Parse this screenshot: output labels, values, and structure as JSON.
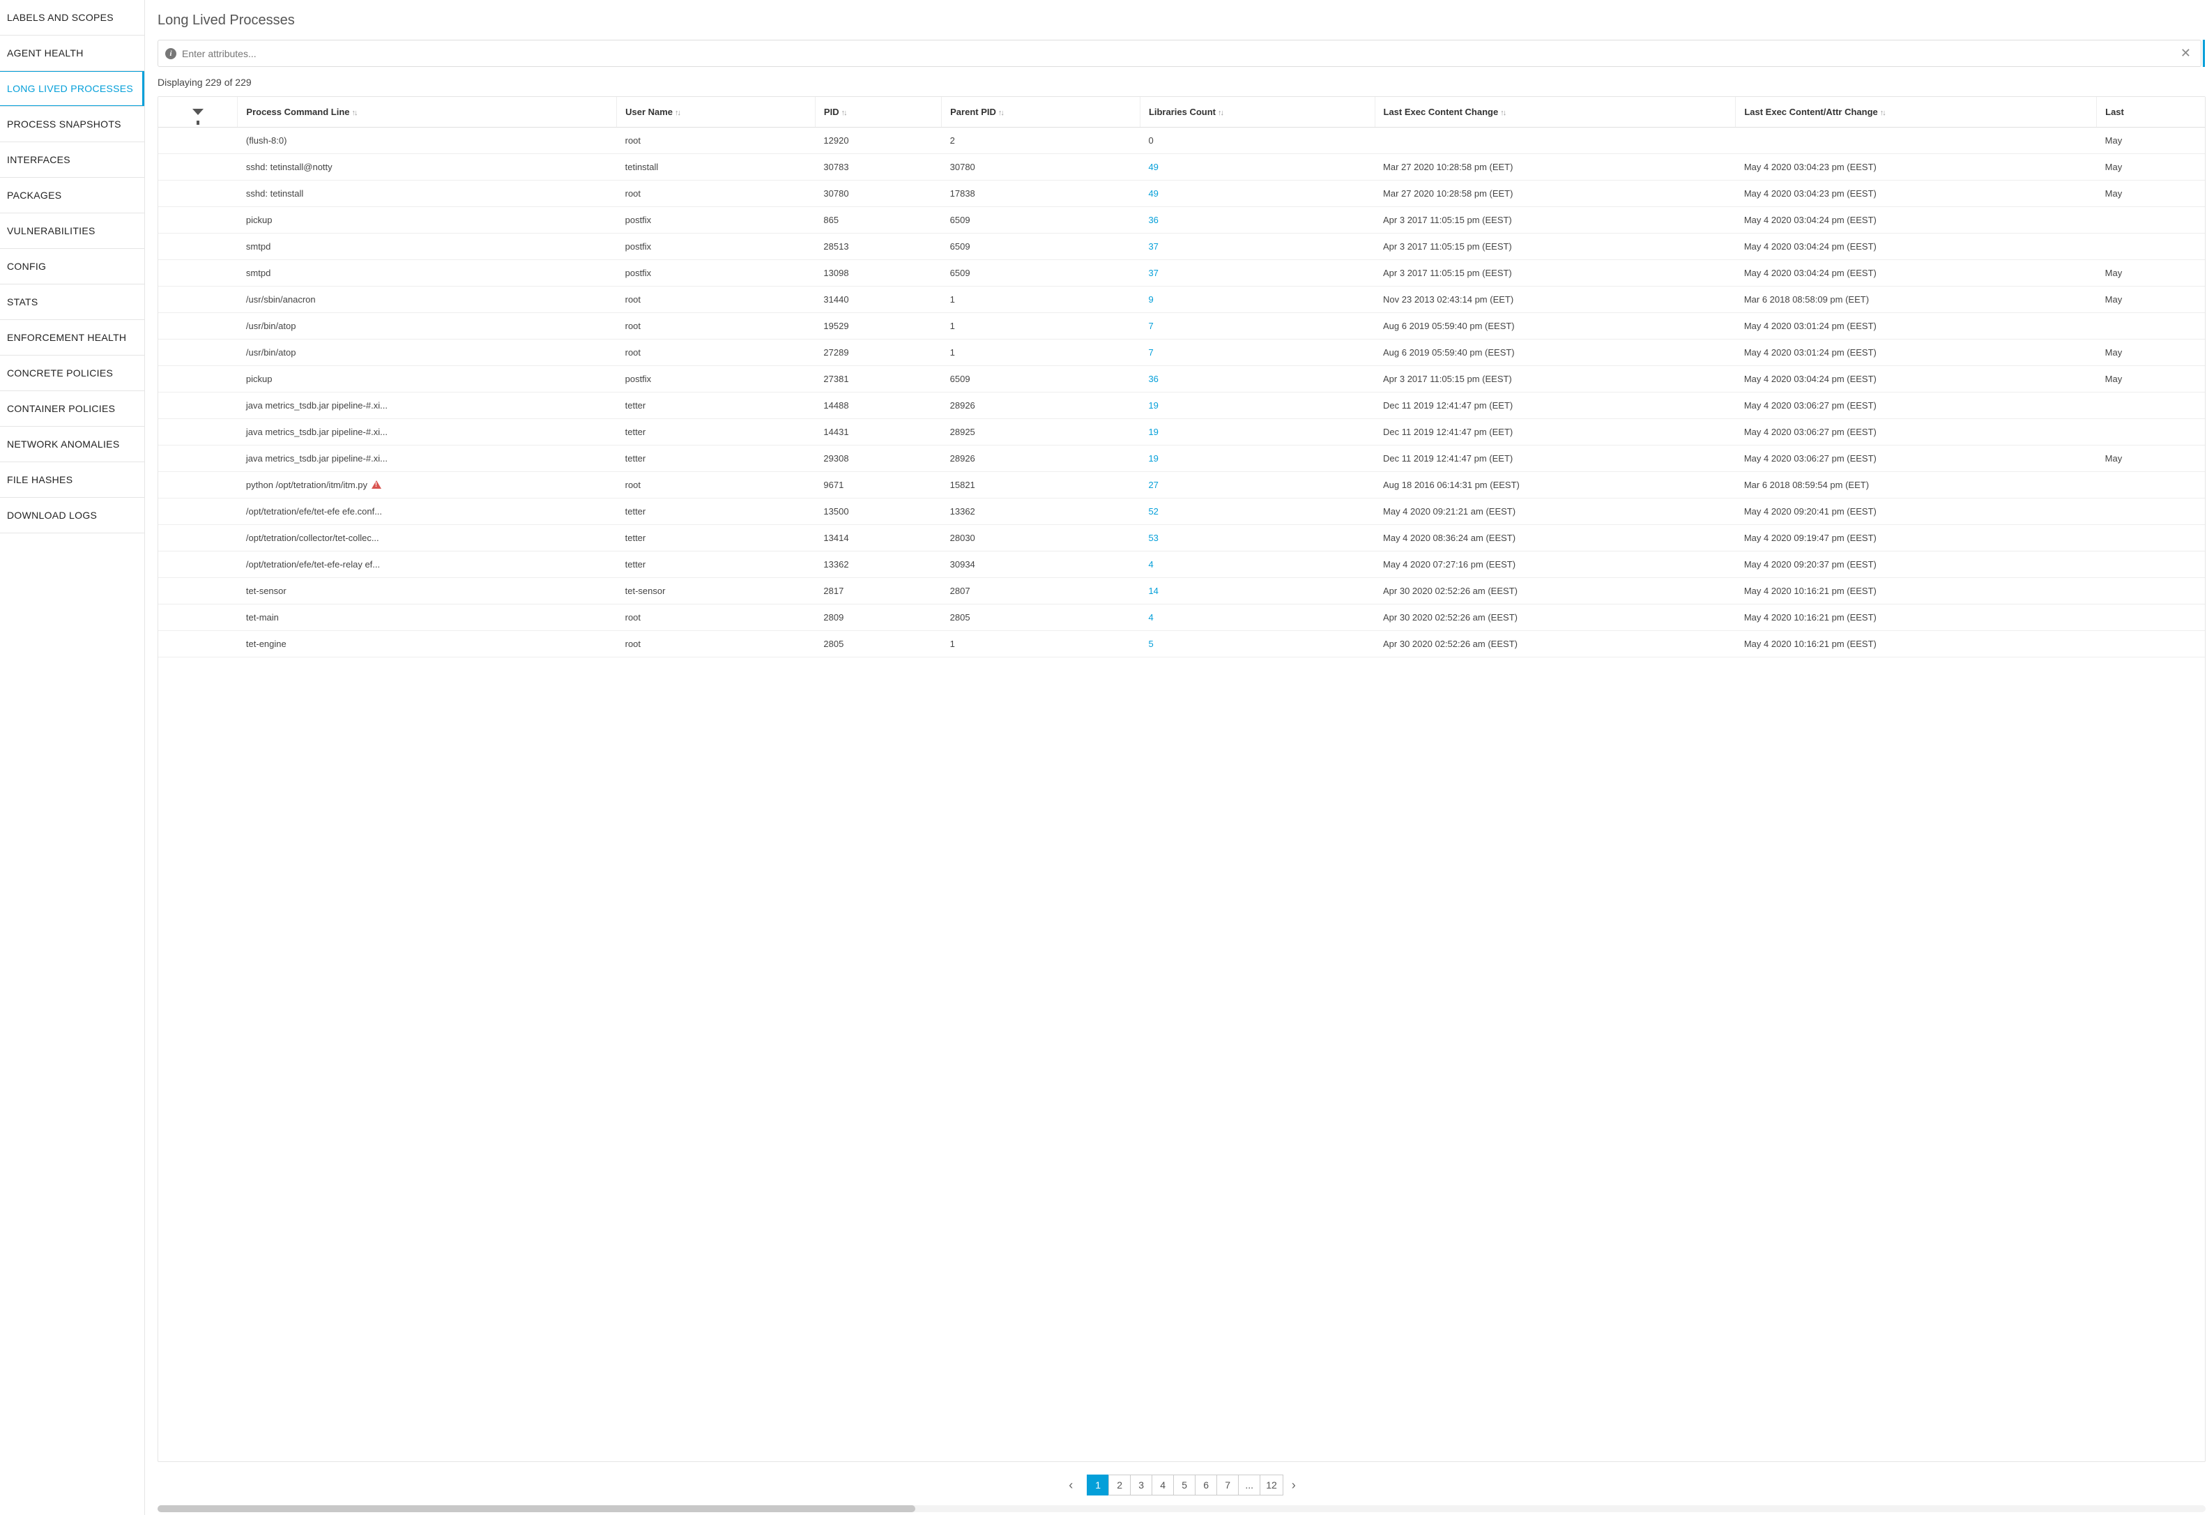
{
  "sidebar": {
    "items": [
      {
        "label": "LABELS AND SCOPES",
        "active": false
      },
      {
        "label": "AGENT HEALTH",
        "active": false
      },
      {
        "label": "LONG LIVED PROCESSES",
        "active": true
      },
      {
        "label": "PROCESS SNAPSHOTS",
        "active": false
      },
      {
        "label": "INTERFACES",
        "active": false
      },
      {
        "label": "PACKAGES",
        "active": false
      },
      {
        "label": "VULNERABILITIES",
        "active": false
      },
      {
        "label": "CONFIG",
        "active": false
      },
      {
        "label": "STATS",
        "active": false
      },
      {
        "label": "ENFORCEMENT HEALTH",
        "active": false
      },
      {
        "label": "CONCRETE POLICIES",
        "active": false
      },
      {
        "label": "CONTAINER POLICIES",
        "active": false
      },
      {
        "label": "NETWORK ANOMALIES",
        "active": false
      },
      {
        "label": "FILE HASHES",
        "active": false
      },
      {
        "label": "DOWNLOAD LOGS",
        "active": false
      }
    ]
  },
  "header": {
    "title": "Long Lived Processes",
    "filter_placeholder": "Enter attributes...",
    "count_text": "Displaying 229 of 229"
  },
  "table": {
    "columns": [
      "Process Command Line",
      "User Name",
      "PID",
      "Parent PID",
      "Libraries Count",
      "Last Exec Content Change",
      "Last Exec Content/Attr Change",
      "Last"
    ],
    "rows": [
      {
        "cmd": "(flush-8:0)",
        "warn": false,
        "user": "root",
        "pid": "12920",
        "ppid": "2",
        "libs": "0",
        "libs_link": false,
        "exec1": "",
        "exec2": "",
        "exec3": "May"
      },
      {
        "cmd": "sshd: tetinstall@notty",
        "warn": false,
        "user": "tetinstall",
        "pid": "30783",
        "ppid": "30780",
        "libs": "49",
        "libs_link": true,
        "exec1": "Mar 27 2020 10:28:58 pm (EET)",
        "exec2": "May 4 2020 03:04:23 pm (EEST)",
        "exec3": "May"
      },
      {
        "cmd": "sshd: tetinstall",
        "warn": false,
        "user": "root",
        "pid": "30780",
        "ppid": "17838",
        "libs": "49",
        "libs_link": true,
        "exec1": "Mar 27 2020 10:28:58 pm (EET)",
        "exec2": "May 4 2020 03:04:23 pm (EEST)",
        "exec3": "May"
      },
      {
        "cmd": "pickup",
        "warn": false,
        "user": "postfix",
        "pid": "865",
        "ppid": "6509",
        "libs": "36",
        "libs_link": true,
        "exec1": "Apr 3 2017 11:05:15 pm (EEST)",
        "exec2": "May 4 2020 03:04:24 pm (EEST)",
        "exec3": ""
      },
      {
        "cmd": "smtpd",
        "warn": false,
        "user": "postfix",
        "pid": "28513",
        "ppid": "6509",
        "libs": "37",
        "libs_link": true,
        "exec1": "Apr 3 2017 11:05:15 pm (EEST)",
        "exec2": "May 4 2020 03:04:24 pm (EEST)",
        "exec3": ""
      },
      {
        "cmd": "smtpd",
        "warn": false,
        "user": "postfix",
        "pid": "13098",
        "ppid": "6509",
        "libs": "37",
        "libs_link": true,
        "exec1": "Apr 3 2017 11:05:15 pm (EEST)",
        "exec2": "May 4 2020 03:04:24 pm (EEST)",
        "exec3": "May"
      },
      {
        "cmd": "/usr/sbin/anacron",
        "warn": false,
        "user": "root",
        "pid": "31440",
        "ppid": "1",
        "libs": "9",
        "libs_link": true,
        "exec1": "Nov 23 2013 02:43:14 pm (EET)",
        "exec2": "Mar 6 2018 08:58:09 pm (EET)",
        "exec3": "May"
      },
      {
        "cmd": "/usr/bin/atop",
        "warn": false,
        "user": "root",
        "pid": "19529",
        "ppid": "1",
        "libs": "7",
        "libs_link": true,
        "exec1": "Aug 6 2019 05:59:40 pm (EEST)",
        "exec2": "May 4 2020 03:01:24 pm (EEST)",
        "exec3": ""
      },
      {
        "cmd": "/usr/bin/atop",
        "warn": false,
        "user": "root",
        "pid": "27289",
        "ppid": "1",
        "libs": "7",
        "libs_link": true,
        "exec1": "Aug 6 2019 05:59:40 pm (EEST)",
        "exec2": "May 4 2020 03:01:24 pm (EEST)",
        "exec3": "May"
      },
      {
        "cmd": "pickup",
        "warn": false,
        "user": "postfix",
        "pid": "27381",
        "ppid": "6509",
        "libs": "36",
        "libs_link": true,
        "exec1": "Apr 3 2017 11:05:15 pm (EEST)",
        "exec2": "May 4 2020 03:04:24 pm (EEST)",
        "exec3": "May"
      },
      {
        "cmd": "java metrics_tsdb.jar pipeline-#.xi...",
        "warn": false,
        "user": "tetter",
        "pid": "14488",
        "ppid": "28926",
        "libs": "19",
        "libs_link": true,
        "exec1": "Dec 11 2019 12:41:47 pm (EET)",
        "exec2": "May 4 2020 03:06:27 pm (EEST)",
        "exec3": ""
      },
      {
        "cmd": "java metrics_tsdb.jar pipeline-#.xi...",
        "warn": false,
        "user": "tetter",
        "pid": "14431",
        "ppid": "28925",
        "libs": "19",
        "libs_link": true,
        "exec1": "Dec 11 2019 12:41:47 pm (EET)",
        "exec2": "May 4 2020 03:06:27 pm (EEST)",
        "exec3": ""
      },
      {
        "cmd": "java metrics_tsdb.jar pipeline-#.xi...",
        "warn": false,
        "user": "tetter",
        "pid": "29308",
        "ppid": "28926",
        "libs": "19",
        "libs_link": true,
        "exec1": "Dec 11 2019 12:41:47 pm (EET)",
        "exec2": "May 4 2020 03:06:27 pm (EEST)",
        "exec3": "May"
      },
      {
        "cmd": "python /opt/tetration/itm/itm.py",
        "warn": true,
        "user": "root",
        "pid": "9671",
        "ppid": "15821",
        "libs": "27",
        "libs_link": true,
        "exec1": "Aug 18 2016 06:14:31 pm (EEST)",
        "exec2": "Mar 6 2018 08:59:54 pm (EET)",
        "exec3": ""
      },
      {
        "cmd": "/opt/tetration/efe/tet-efe efe.conf...",
        "warn": false,
        "user": "tetter",
        "pid": "13500",
        "ppid": "13362",
        "libs": "52",
        "libs_link": true,
        "exec1": "May 4 2020 09:21:21 am (EEST)",
        "exec2": "May 4 2020 09:20:41 pm (EEST)",
        "exec3": ""
      },
      {
        "cmd": "/opt/tetration/collector/tet-collec...",
        "warn": false,
        "user": "tetter",
        "pid": "13414",
        "ppid": "28030",
        "libs": "53",
        "libs_link": true,
        "exec1": "May 4 2020 08:36:24 am (EEST)",
        "exec2": "May 4 2020 09:19:47 pm (EEST)",
        "exec3": ""
      },
      {
        "cmd": "/opt/tetration/efe/tet-efe-relay ef...",
        "warn": false,
        "user": "tetter",
        "pid": "13362",
        "ppid": "30934",
        "libs": "4",
        "libs_link": true,
        "exec1": "May 4 2020 07:27:16 pm (EEST)",
        "exec2": "May 4 2020 09:20:37 pm (EEST)",
        "exec3": ""
      },
      {
        "cmd": "tet-sensor",
        "warn": false,
        "user": "tet-sensor",
        "pid": "2817",
        "ppid": "2807",
        "libs": "14",
        "libs_link": true,
        "exec1": "Apr 30 2020 02:52:26 am (EEST)",
        "exec2": "May 4 2020 10:16:21 pm (EEST)",
        "exec3": ""
      },
      {
        "cmd": "tet-main",
        "warn": false,
        "user": "root",
        "pid": "2809",
        "ppid": "2805",
        "libs": "4",
        "libs_link": true,
        "exec1": "Apr 30 2020 02:52:26 am (EEST)",
        "exec2": "May 4 2020 10:16:21 pm (EEST)",
        "exec3": ""
      },
      {
        "cmd": "tet-engine",
        "warn": false,
        "user": "root",
        "pid": "2805",
        "ppid": "1",
        "libs": "5",
        "libs_link": true,
        "exec1": "Apr 30 2020 02:52:26 am (EEST)",
        "exec2": "May 4 2020 10:16:21 pm (EEST)",
        "exec3": ""
      }
    ]
  },
  "pagination": {
    "pages": [
      "1",
      "2",
      "3",
      "4",
      "5",
      "6",
      "7",
      "...",
      "12"
    ],
    "active": "1"
  }
}
